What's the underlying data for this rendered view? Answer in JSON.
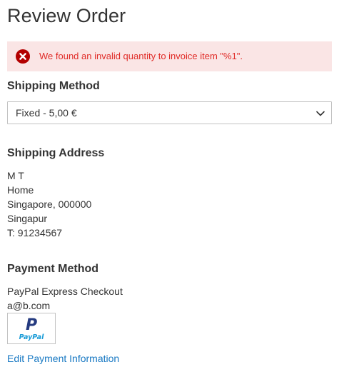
{
  "page": {
    "title": "Review Order"
  },
  "error_message": {
    "text": "We found an invalid quantity to invoice item \"%1\".",
    "icon": "error-circle-icon",
    "color": "#e02b27",
    "background": "#fae5e5"
  },
  "shipping_method": {
    "heading": "Shipping Method",
    "selected_value": "Fixed - 5,00 €",
    "dropdown_icon": "chevron-down-icon"
  },
  "shipping_address": {
    "heading": "Shipping Address",
    "lines": [
      "M T",
      "Home",
      "Singapore, 000000",
      "Singapur",
      "T: 91234567"
    ]
  },
  "payment_method": {
    "heading": "Payment Method",
    "method_name": "PayPal Express Checkout",
    "email": "a@b.com",
    "logo_text": "PayPal",
    "logo_mark": "P",
    "edit_link": "Edit Payment Information",
    "link_color": "#1979c3"
  }
}
